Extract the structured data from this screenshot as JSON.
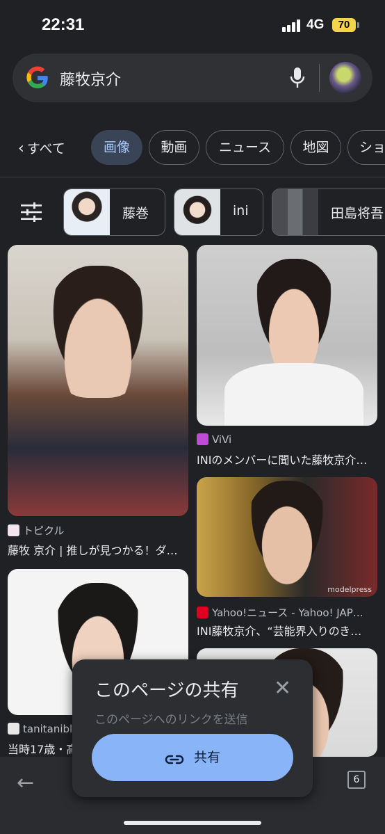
{
  "status": {
    "time": "22:31",
    "network": "4G",
    "battery": "70"
  },
  "search": {
    "query": "藤牧京介"
  },
  "tabs": {
    "back_all": "すべて",
    "items": [
      "画像",
      "動画",
      "ニュース",
      "地図",
      "ショ"
    ],
    "active": "画像"
  },
  "filters": {
    "chips": [
      "藤巻",
      "ini",
      "田島将吾"
    ]
  },
  "results": [
    {
      "source": "トピクル",
      "caption": "藤牧 京介 | 推しが見つかる！ダ…"
    },
    {
      "source": "ViVi",
      "caption": "INIのメンバーに聞いた藤牧京介…"
    },
    {
      "source": "Yahoo!ニュース - Yahoo! JAP…",
      "caption": "INI藤牧京介、“芸能界入りのき…"
    },
    {
      "source": "tanitaniblo",
      "caption": "当時17歳・高"
    }
  ],
  "watermark": "modelpress",
  "share_popup": {
    "title": "このページの共有",
    "subtitle": "このページへのリンクを送信",
    "button": "共有"
  },
  "bottom_bar": {
    "tab_count": "6"
  },
  "colors": {
    "background": "#202124",
    "active_chip": "#394457",
    "share_button": "#8ab4f8"
  }
}
